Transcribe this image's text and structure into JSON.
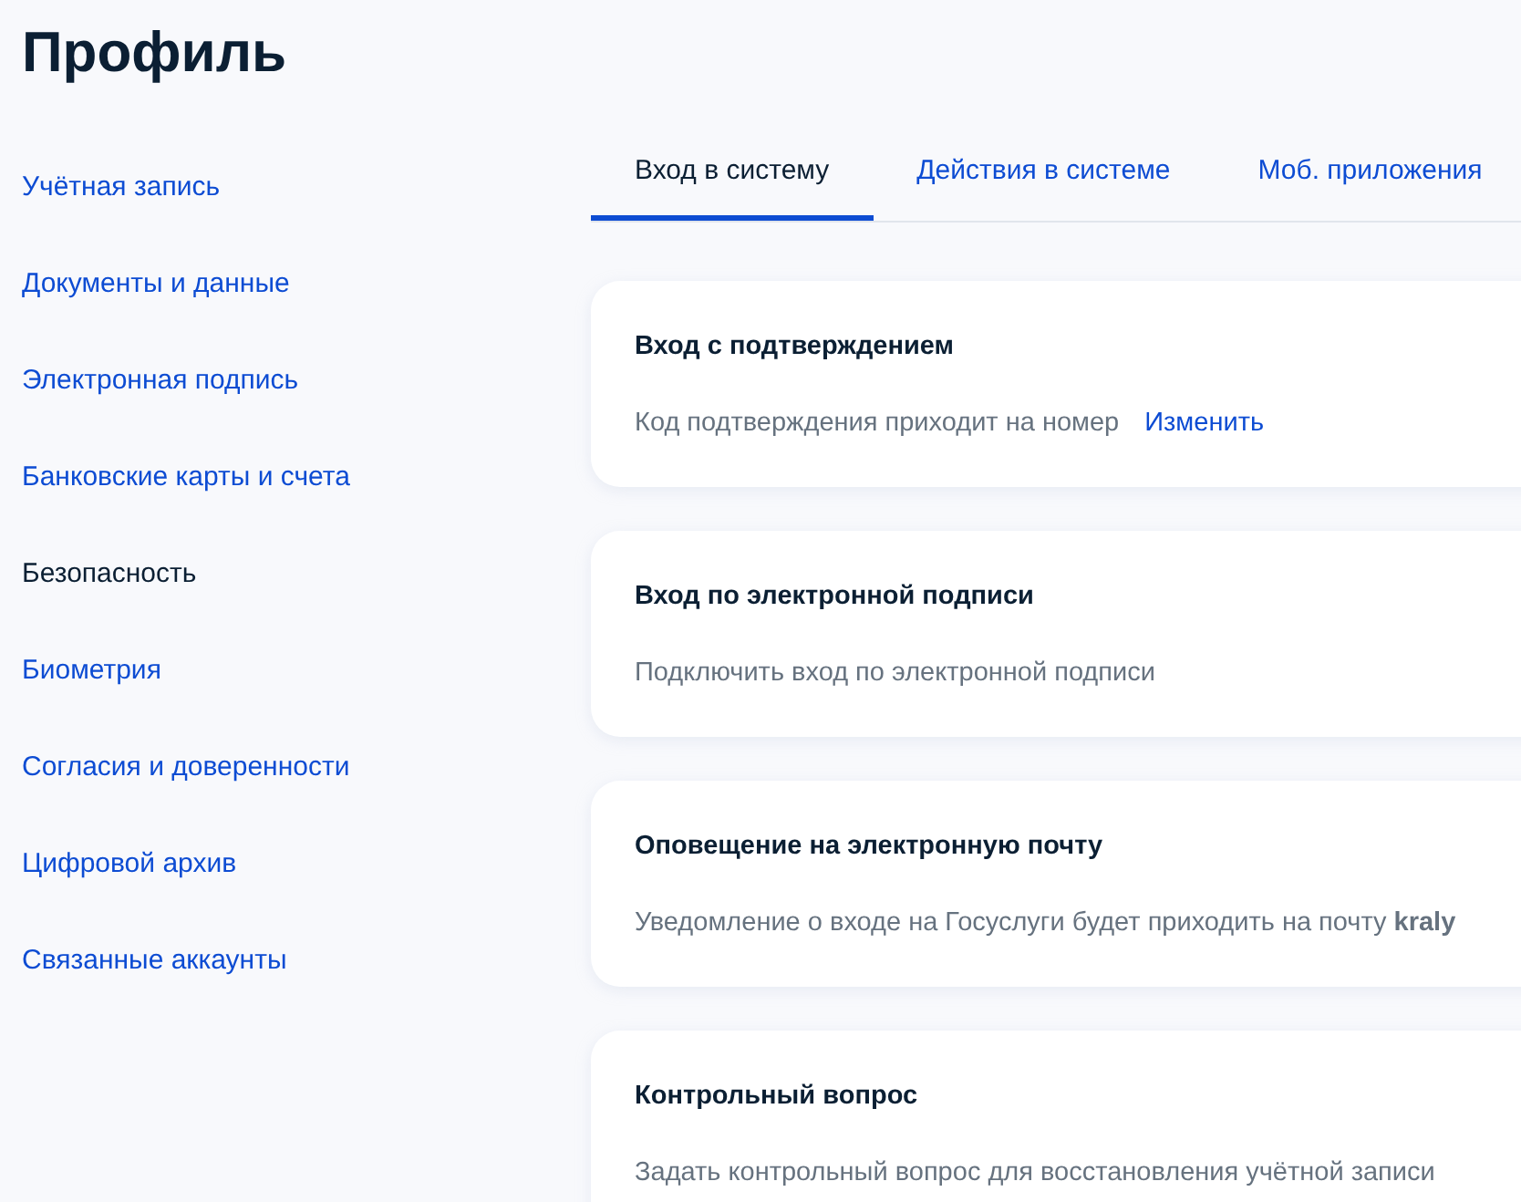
{
  "title": "Профиль",
  "sidebar": {
    "items": [
      {
        "label": "Учётная запись",
        "selected": false
      },
      {
        "label": "Документы и данные",
        "selected": false
      },
      {
        "label": "Электронная подпись",
        "selected": false
      },
      {
        "label": "Банковские карты и счета",
        "selected": false
      },
      {
        "label": "Безопасность",
        "selected": true
      },
      {
        "label": "Биометрия",
        "selected": false
      },
      {
        "label": "Согласия и доверенности",
        "selected": false
      },
      {
        "label": "Цифровой архив",
        "selected": false
      },
      {
        "label": "Связанные аккаунты",
        "selected": false
      }
    ]
  },
  "tabs": [
    {
      "label": "Вход в систему",
      "selected": true
    },
    {
      "label": "Действия в системе",
      "selected": false
    },
    {
      "label": "Моб. приложения",
      "selected": false
    }
  ],
  "cards": [
    {
      "title": "Вход с подтверждением",
      "text": "Код подтверждения приходит на номер",
      "link": "Изменить"
    },
    {
      "title": "Вход по электронной подписи",
      "text": "Подключить вход по электронной подписи"
    },
    {
      "title": "Оповещение на электронную почту",
      "text": "Уведомление о входе на Госуслуги будет приходить на почту **kraly**"
    },
    {
      "title": "Контрольный вопрос",
      "text": "Задать контрольный вопрос для восстановления учётной записи"
    }
  ]
}
